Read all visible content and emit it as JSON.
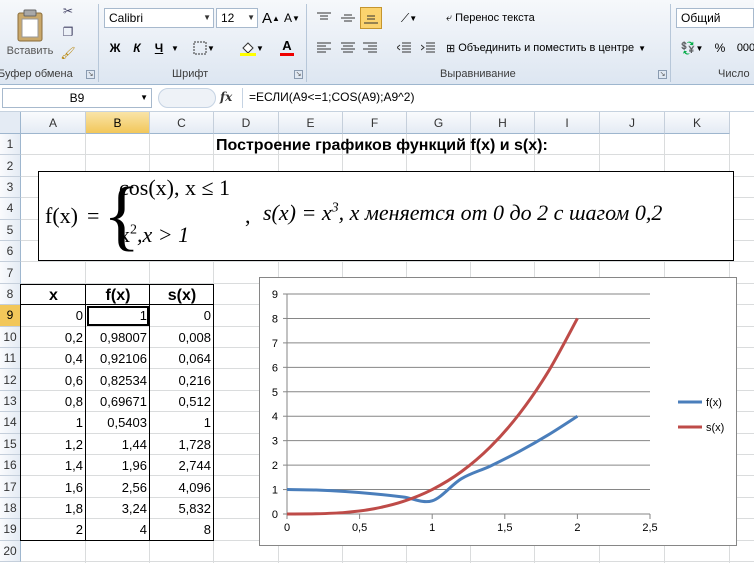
{
  "ribbon": {
    "paste_label": "Вставить",
    "clipboard_group": "Буфер обмена",
    "font_name": "Calibri",
    "font_size": "12",
    "bold_label": "Ж",
    "italic_label": "К",
    "underline_label": "Ч",
    "font_group": "Шрифт",
    "wrap_text_label": "Перенос текста",
    "merge_label": "Объединить и поместить в центре",
    "alignment_group": "Выравнивание",
    "number_format": "Общий",
    "percent_label": "%",
    "thousands_label": "000",
    "number_group": "Число",
    "grow_font_label": "A",
    "shrink_font_label": "A",
    "font_color_label": "A"
  },
  "formula_bar": {
    "name_box": "B9",
    "fx_label": "fx",
    "formula": "=ЕСЛИ(A9<=1;COS(A9);A9^2)"
  },
  "columns": [
    "A",
    "B",
    "C",
    "D",
    "E",
    "F",
    "G",
    "H",
    "I",
    "J",
    "K"
  ],
  "rows": [
    "1",
    "2",
    "3",
    "4",
    "5",
    "6",
    "7",
    "8",
    "9",
    "10",
    "11",
    "12",
    "13",
    "14",
    "15",
    "16",
    "17",
    "18",
    "19",
    "20"
  ],
  "sheet": {
    "title": "Построение графиков функций f(x) и s(x):",
    "formula_box": {
      "f_lhs": "f(x)",
      "eq": "=",
      "case1": "cos(x),  x ≤ 1",
      "case2_x": "x",
      "case2_exp": "2",
      "case2_rest": ",x > 1",
      "comma": ",",
      "s_lhs": "s(x) = x",
      "s_exp": "3",
      "s_rest": ",  x меняется  от 0 до 2 с шагом  0,2"
    },
    "table_headers": [
      "x",
      "f(x)",
      "s(x)"
    ],
    "table_rows": [
      [
        "0",
        "1",
        "0"
      ],
      [
        "0,2",
        "0,98007",
        "0,008"
      ],
      [
        "0,4",
        "0,92106",
        "0,064"
      ],
      [
        "0,6",
        "0,82534",
        "0,216"
      ],
      [
        "0,8",
        "0,69671",
        "0,512"
      ],
      [
        "1",
        "0,5403",
        "1"
      ],
      [
        "1,2",
        "1,44",
        "1,728"
      ],
      [
        "1,4",
        "1,96",
        "2,744"
      ],
      [
        "1,6",
        "2,56",
        "4,096"
      ],
      [
        "1,8",
        "3,24",
        "5,832"
      ],
      [
        "2",
        "4",
        "8"
      ]
    ]
  },
  "chart_data": {
    "type": "line",
    "x": [
      0,
      0.2,
      0.4,
      0.6,
      0.8,
      1,
      1.2,
      1.4,
      1.6,
      1.8,
      2
    ],
    "series": [
      {
        "name": "f(x)",
        "color": "#4a7ebb",
        "values": [
          1,
          0.98007,
          0.92106,
          0.82534,
          0.69671,
          0.5403,
          1.44,
          1.96,
          2.56,
          3.24,
          4
        ]
      },
      {
        "name": "s(x)",
        "color": "#be4b48",
        "values": [
          0,
          0.008,
          0.064,
          0.216,
          0.512,
          1,
          1.728,
          2.744,
          4.096,
          5.832,
          8
        ]
      }
    ],
    "xlim": [
      0,
      2.5
    ],
    "ylim": [
      0,
      9
    ],
    "x_ticks": [
      "0",
      "0,5",
      "1",
      "1,5",
      "2",
      "2,5"
    ],
    "y_ticks": [
      "0",
      "1",
      "2",
      "3",
      "4",
      "5",
      "6",
      "7",
      "8",
      "9"
    ],
    "grid": "horizontal",
    "legend": "right"
  }
}
